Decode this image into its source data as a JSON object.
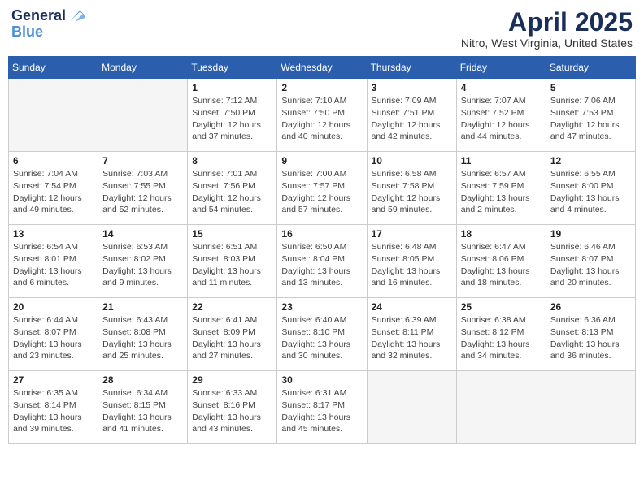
{
  "header": {
    "logo_line1": "General",
    "logo_line2": "Blue",
    "month": "April 2025",
    "location": "Nitro, West Virginia, United States"
  },
  "days_of_week": [
    "Sunday",
    "Monday",
    "Tuesday",
    "Wednesday",
    "Thursday",
    "Friday",
    "Saturday"
  ],
  "weeks": [
    [
      {
        "day": "",
        "info": ""
      },
      {
        "day": "",
        "info": ""
      },
      {
        "day": "1",
        "info": "Sunrise: 7:12 AM\nSunset: 7:50 PM\nDaylight: 12 hours\nand 37 minutes."
      },
      {
        "day": "2",
        "info": "Sunrise: 7:10 AM\nSunset: 7:50 PM\nDaylight: 12 hours\nand 40 minutes."
      },
      {
        "day": "3",
        "info": "Sunrise: 7:09 AM\nSunset: 7:51 PM\nDaylight: 12 hours\nand 42 minutes."
      },
      {
        "day": "4",
        "info": "Sunrise: 7:07 AM\nSunset: 7:52 PM\nDaylight: 12 hours\nand 44 minutes."
      },
      {
        "day": "5",
        "info": "Sunrise: 7:06 AM\nSunset: 7:53 PM\nDaylight: 12 hours\nand 47 minutes."
      }
    ],
    [
      {
        "day": "6",
        "info": "Sunrise: 7:04 AM\nSunset: 7:54 PM\nDaylight: 12 hours\nand 49 minutes."
      },
      {
        "day": "7",
        "info": "Sunrise: 7:03 AM\nSunset: 7:55 PM\nDaylight: 12 hours\nand 52 minutes."
      },
      {
        "day": "8",
        "info": "Sunrise: 7:01 AM\nSunset: 7:56 PM\nDaylight: 12 hours\nand 54 minutes."
      },
      {
        "day": "9",
        "info": "Sunrise: 7:00 AM\nSunset: 7:57 PM\nDaylight: 12 hours\nand 57 minutes."
      },
      {
        "day": "10",
        "info": "Sunrise: 6:58 AM\nSunset: 7:58 PM\nDaylight: 12 hours\nand 59 minutes."
      },
      {
        "day": "11",
        "info": "Sunrise: 6:57 AM\nSunset: 7:59 PM\nDaylight: 13 hours\nand 2 minutes."
      },
      {
        "day": "12",
        "info": "Sunrise: 6:55 AM\nSunset: 8:00 PM\nDaylight: 13 hours\nand 4 minutes."
      }
    ],
    [
      {
        "day": "13",
        "info": "Sunrise: 6:54 AM\nSunset: 8:01 PM\nDaylight: 13 hours\nand 6 minutes."
      },
      {
        "day": "14",
        "info": "Sunrise: 6:53 AM\nSunset: 8:02 PM\nDaylight: 13 hours\nand 9 minutes."
      },
      {
        "day": "15",
        "info": "Sunrise: 6:51 AM\nSunset: 8:03 PM\nDaylight: 13 hours\nand 11 minutes."
      },
      {
        "day": "16",
        "info": "Sunrise: 6:50 AM\nSunset: 8:04 PM\nDaylight: 13 hours\nand 13 minutes."
      },
      {
        "day": "17",
        "info": "Sunrise: 6:48 AM\nSunset: 8:05 PM\nDaylight: 13 hours\nand 16 minutes."
      },
      {
        "day": "18",
        "info": "Sunrise: 6:47 AM\nSunset: 8:06 PM\nDaylight: 13 hours\nand 18 minutes."
      },
      {
        "day": "19",
        "info": "Sunrise: 6:46 AM\nSunset: 8:07 PM\nDaylight: 13 hours\nand 20 minutes."
      }
    ],
    [
      {
        "day": "20",
        "info": "Sunrise: 6:44 AM\nSunset: 8:07 PM\nDaylight: 13 hours\nand 23 minutes."
      },
      {
        "day": "21",
        "info": "Sunrise: 6:43 AM\nSunset: 8:08 PM\nDaylight: 13 hours\nand 25 minutes."
      },
      {
        "day": "22",
        "info": "Sunrise: 6:41 AM\nSunset: 8:09 PM\nDaylight: 13 hours\nand 27 minutes."
      },
      {
        "day": "23",
        "info": "Sunrise: 6:40 AM\nSunset: 8:10 PM\nDaylight: 13 hours\nand 30 minutes."
      },
      {
        "day": "24",
        "info": "Sunrise: 6:39 AM\nSunset: 8:11 PM\nDaylight: 13 hours\nand 32 minutes."
      },
      {
        "day": "25",
        "info": "Sunrise: 6:38 AM\nSunset: 8:12 PM\nDaylight: 13 hours\nand 34 minutes."
      },
      {
        "day": "26",
        "info": "Sunrise: 6:36 AM\nSunset: 8:13 PM\nDaylight: 13 hours\nand 36 minutes."
      }
    ],
    [
      {
        "day": "27",
        "info": "Sunrise: 6:35 AM\nSunset: 8:14 PM\nDaylight: 13 hours\nand 39 minutes."
      },
      {
        "day": "28",
        "info": "Sunrise: 6:34 AM\nSunset: 8:15 PM\nDaylight: 13 hours\nand 41 minutes."
      },
      {
        "day": "29",
        "info": "Sunrise: 6:33 AM\nSunset: 8:16 PM\nDaylight: 13 hours\nand 43 minutes."
      },
      {
        "day": "30",
        "info": "Sunrise: 6:31 AM\nSunset: 8:17 PM\nDaylight: 13 hours\nand 45 minutes."
      },
      {
        "day": "",
        "info": ""
      },
      {
        "day": "",
        "info": ""
      },
      {
        "day": "",
        "info": ""
      }
    ]
  ]
}
